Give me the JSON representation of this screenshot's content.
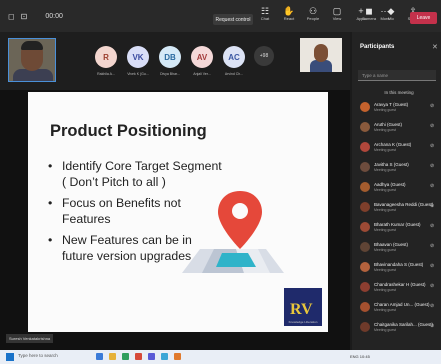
{
  "topbar": {
    "timer": "00:00",
    "request_control": "Request control",
    "tools": [
      {
        "icon": "☷",
        "label": "Chat"
      },
      {
        "icon": "✋",
        "label": "React"
      },
      {
        "icon": "⚇",
        "label": "People"
      },
      {
        "icon": "▢",
        "label": "View"
      },
      {
        "icon": "+",
        "label": "Apps"
      },
      {
        "icon": "⋯",
        "label": "More"
      }
    ],
    "tools2": [
      {
        "icon": "◼",
        "label": "Camera"
      },
      {
        "icon": "◆",
        "label": "Mic"
      },
      {
        "icon": "⇪",
        "label": "Share"
      }
    ],
    "leave_label": "Leave"
  },
  "strip": {
    "avatars": [
      {
        "initials": "R",
        "name": "Rakhila A...",
        "color": "#f3d6cf",
        "text": "#9b3d2c"
      },
      {
        "initials": "VK",
        "name": "Vivek K (Gu...",
        "color": "#d9def7",
        "text": "#3a4aa0"
      },
      {
        "initials": "DB",
        "name": "Divya Bhar...",
        "color": "#d5e9f7",
        "text": "#2b6aa0"
      },
      {
        "initials": "AV",
        "name": "Anjali Ver...",
        "color": "#f5d9d9",
        "text": "#a33b3b"
      },
      {
        "initials": "AC",
        "name": "Arvind Ch...",
        "color": "#dce3f5",
        "text": "#3b58a3"
      }
    ],
    "more_label": "+98"
  },
  "slide": {
    "title": "Product Positioning",
    "bullets": [
      "Identify Core Target Segment ( Don’t Pitch to all )",
      "Focus on Benefits not Features",
      "New Features can be in future version upgrades"
    ],
    "logo_text": "RV",
    "logo_sub": "Knowledge Liberation"
  },
  "presenter_name": "Suresh Venkatakrishna",
  "panel": {
    "title": "Participants",
    "search_placeholder": "Type a name",
    "section": "In this meeting",
    "people": [
      {
        "name": "Aravya T (Guest)",
        "status": "Meeting guest",
        "color": "#c4622d"
      },
      {
        "name": "Aruthi (Guest)",
        "status": "Meeting guest",
        "color": "#8a5a3c"
      },
      {
        "name": "Archana K (Guest)",
        "status": "Meeting guest",
        "color": "#b0473b"
      },
      {
        "name": "Javitha S (Guest)",
        "status": "Meeting guest",
        "color": "#6d4c3d"
      },
      {
        "name": "Aadhya (Guest)",
        "status": "Meeting guest",
        "color": "#a35c2e"
      },
      {
        "name": "Bavanageesha Reddi (Guest)",
        "status": "Meeting guest",
        "color": "#7e3f2b"
      },
      {
        "name": "Bharath Kumar (Guest)",
        "status": "Meeting guest",
        "color": "#9c4a35"
      },
      {
        "name": "Bhaavan (Guest)",
        "status": "Meeting guest",
        "color": "#5f4435"
      },
      {
        "name": "Bhavinandaha S (Guest)",
        "status": "Meeting guest",
        "color": "#b3623d"
      },
      {
        "name": "Chandrashekar H (Guest)",
        "status": "Meeting guest",
        "color": "#8c3e30"
      },
      {
        "name": "Charan Amjad Un... (Guest)",
        "status": "Meeting guest",
        "color": "#a4502f"
      },
      {
        "name": "Chaitganika Sarilah... (Guest)",
        "status": "Meeting guest",
        "color": "#6e3a2a"
      }
    ]
  },
  "taskbar": {
    "search_text": "Type here to search",
    "tray": "ENG  10:45"
  }
}
